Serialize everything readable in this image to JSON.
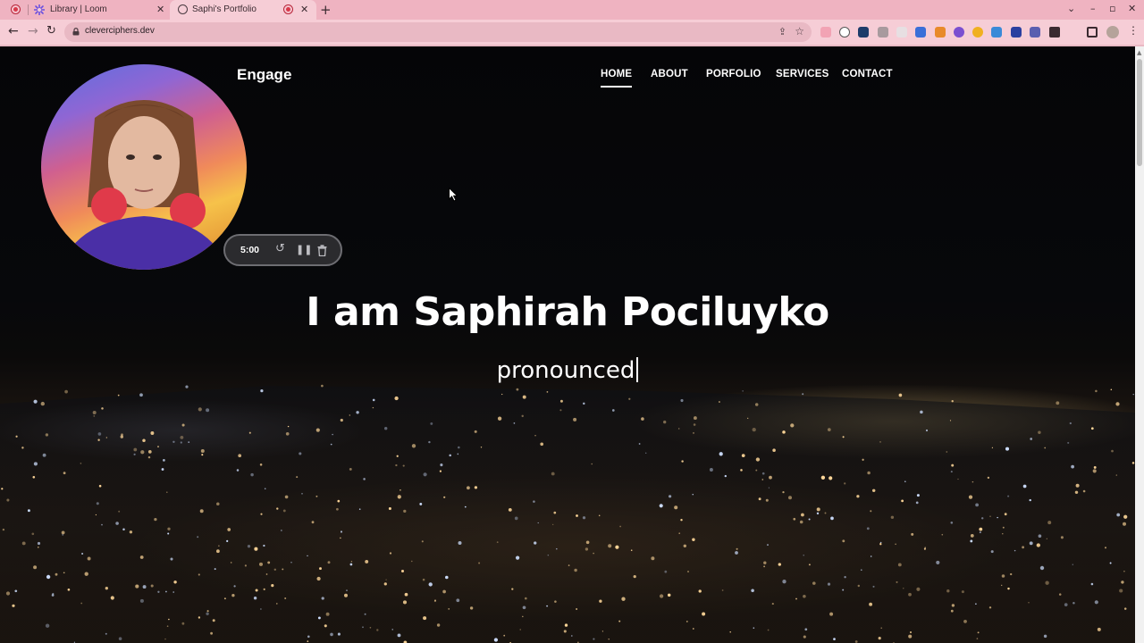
{
  "browser": {
    "tabs": [
      {
        "title": "Library | Loom",
        "active": false
      },
      {
        "title": "Saphi's Portfolio",
        "active": true
      }
    ],
    "new_tab_icon": "plus-icon",
    "url": "cleverciphers.dev"
  },
  "site": {
    "brand": "Engage",
    "nav": [
      {
        "label": "HOME",
        "active": true
      },
      {
        "label": "ABOUT",
        "active": false
      },
      {
        "label": "PORFOLIO",
        "active": false
      },
      {
        "label": "SERVICES",
        "active": false
      },
      {
        "label": "CONTACT",
        "active": false
      }
    ],
    "hero": {
      "title": "I am Saphirah Pociluyko",
      "subtitle": "pronounced"
    }
  },
  "loom": {
    "timer": "5:00",
    "controls": [
      "restart-icon",
      "pause-icon",
      "trash-icon"
    ]
  },
  "colors": {
    "tabstrip": "#efb3c1",
    "toolbar": "#f6cdd6",
    "recording": "#d8394a"
  }
}
